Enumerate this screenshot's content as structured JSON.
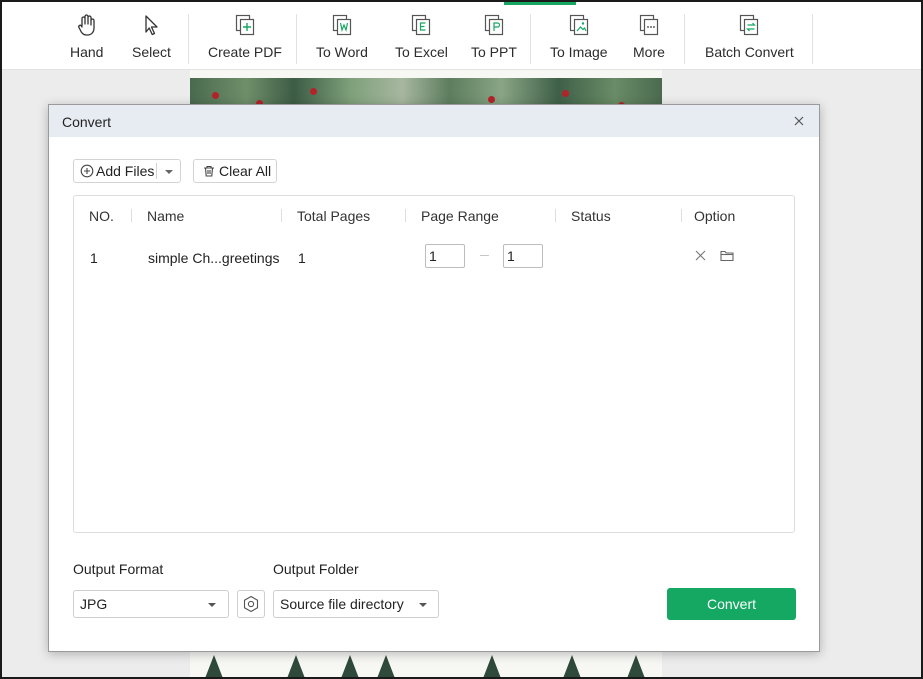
{
  "toolbar": {
    "hand": "Hand",
    "select": "Select",
    "create_pdf": "Create PDF",
    "to_word": "To Word",
    "to_excel": "To Excel",
    "to_ppt": "To PPT",
    "to_image": "To Image",
    "more": "More",
    "batch_convert": "Batch Convert",
    "accent_color": "#16a862"
  },
  "dialog": {
    "title": "Convert",
    "add_files": "Add Files",
    "clear_all": "Clear All",
    "table": {
      "headers": [
        "NO.",
        "Name",
        "Total Pages",
        "Page Range",
        "Status",
        "Option"
      ],
      "rows": [
        {
          "no": "1",
          "name": "simple Ch...greetings",
          "total_pages": "1",
          "range_from": "1",
          "range_to": "1",
          "status": ""
        }
      ]
    },
    "output_format_label": "Output Format",
    "output_format_value": "JPG",
    "output_folder_label": "Output Folder",
    "output_folder_value": "Source file directory",
    "convert_button": "Convert",
    "convert_color": "#14a862"
  }
}
